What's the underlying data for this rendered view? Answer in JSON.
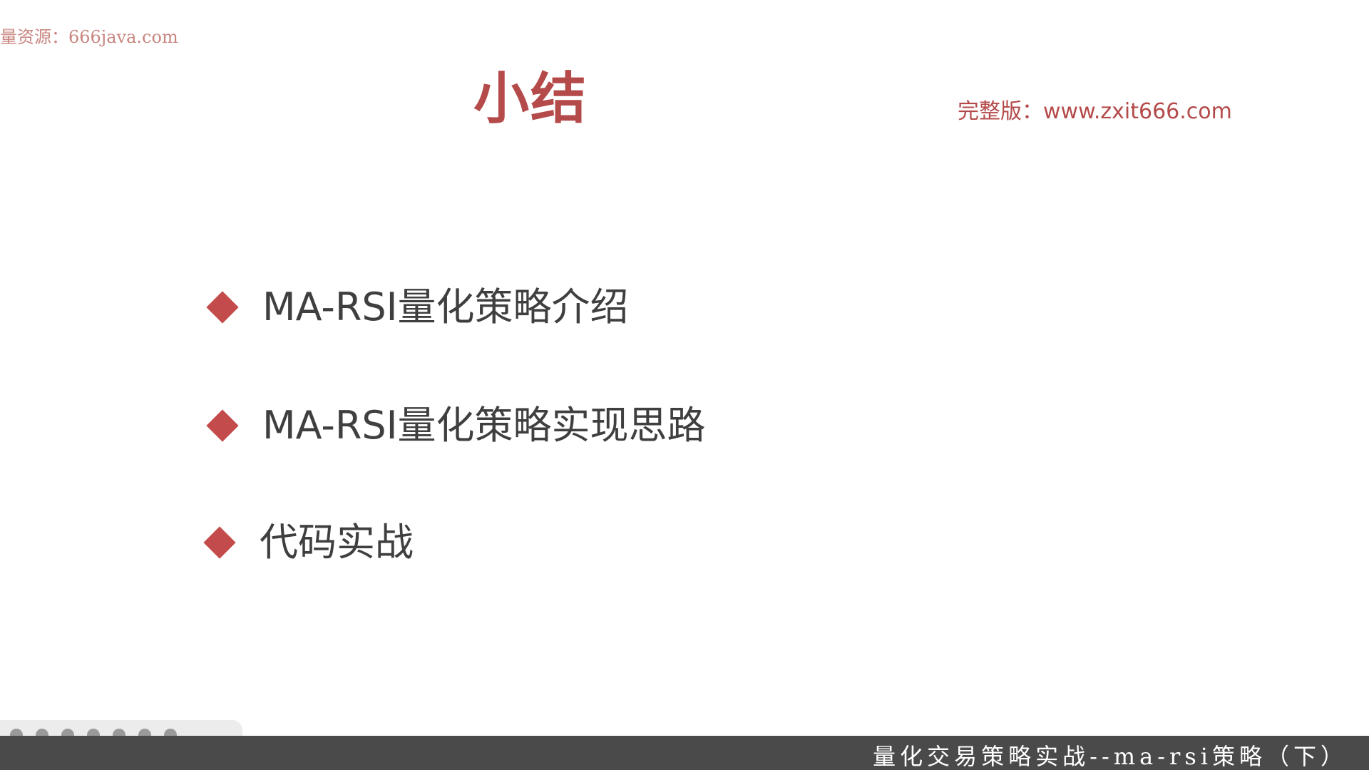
{
  "watermark": {
    "text": "量资源：666java.com"
  },
  "slide": {
    "title": "小结",
    "full_version_text": "完整版：www.zxit666.com",
    "bullets": [
      {
        "text": "MA-RSI量化策略介绍"
      },
      {
        "text": "MA-RSI量化策略实现思路"
      },
      {
        "text": "代码实战"
      }
    ]
  },
  "caption_bar": {
    "text": "量化交易策略实战--ma-rsi策略（下）"
  },
  "colors": {
    "accent": "#b44a4a",
    "bullet_diamond": "#c44b4b",
    "body_text": "#3f3f3f",
    "caption_bar_bg": "#4a4a4a"
  },
  "icons": {
    "bullet": "diamond-icon"
  }
}
